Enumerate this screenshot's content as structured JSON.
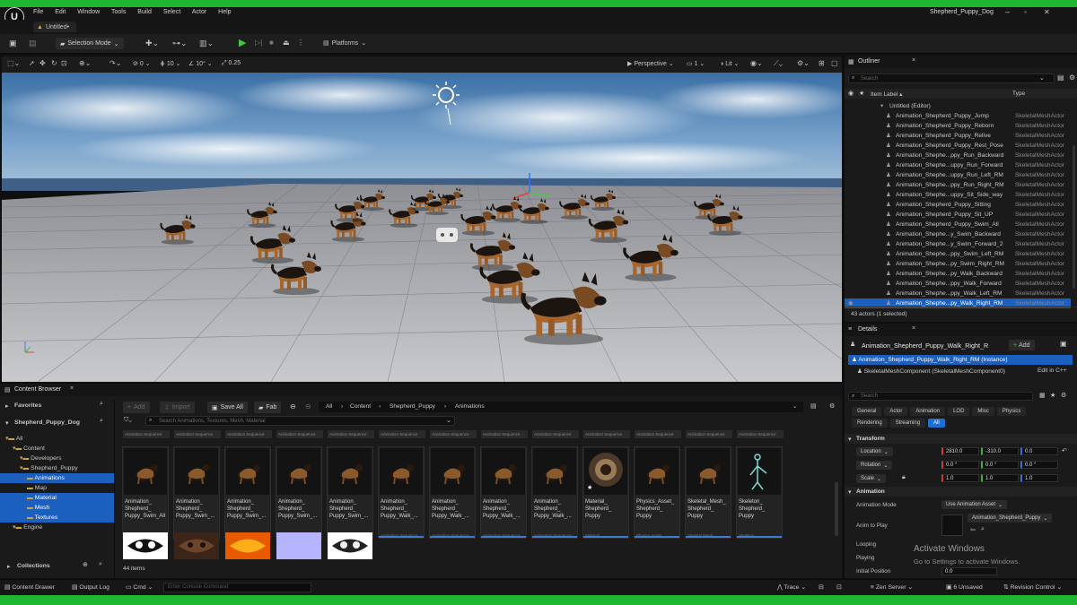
{
  "window": {
    "title": "Shepherd_Puppy_Dog"
  },
  "menu": [
    "File",
    "Edit",
    "Window",
    "Tools",
    "Build",
    "Select",
    "Actor",
    "Help"
  ],
  "tabs": [
    {
      "label": "Untitled•"
    }
  ],
  "toolbar": {
    "selection_mode": "Selection Mode",
    "platforms": "Platforms"
  },
  "viewport_bar": {
    "rot_snap": "0",
    "grid_snap": "10",
    "angle_snap": "10°",
    "scale_snap": "0.25",
    "perspective": "Perspective",
    "camera_count": "1",
    "view_mode": "Lit"
  },
  "outliner": {
    "title": "Outliner",
    "search_placeholder": "Search",
    "col_label": "Item Label ▴",
    "col_type": "Type",
    "root": "Untitled (Editor)",
    "rows": [
      {
        "name": "Animation_Shepherd_Puppy_Jump",
        "type": "SkeletalMeshActor"
      },
      {
        "name": "Animation_Shepherd_Puppy_Reborn",
        "type": "SkeletalMeshActor"
      },
      {
        "name": "Animation_Shepherd_Puppy_Relive",
        "type": "SkeletalMeshActor"
      },
      {
        "name": "Animation_Shepherd_Puppy_Rest_Pose",
        "type": "SkeletalMeshActor"
      },
      {
        "name": "Animation_Shephe...ppy_Run_Backward",
        "type": "SkeletalMeshActor"
      },
      {
        "name": "Animation_Shephe...uppy_Run_Forward",
        "type": "SkeletalMeshActor"
      },
      {
        "name": "Animation_Shephe...uppy_Run_Left_RM",
        "type": "SkeletalMeshActor"
      },
      {
        "name": "Animation_Shephe...ppy_Run_Right_RM",
        "type": "SkeletalMeshActor"
      },
      {
        "name": "Animation_Shephe...uppy_Sit_Side_way",
        "type": "SkeletalMeshActor"
      },
      {
        "name": "Animation_Shepherd_Puppy_Sitting",
        "type": "SkeletalMeshActor"
      },
      {
        "name": "Animation_Shepherd_Puppy_Sit_UP",
        "type": "SkeletalMeshActor"
      },
      {
        "name": "Animation_Shepherd_Puppy_Swim_All",
        "type": "SkeletalMeshActor"
      },
      {
        "name": "Animation_Shephe...y_Swim_Backward",
        "type": "SkeletalMeshActor"
      },
      {
        "name": "Animation_Shephe...y_Swim_Forward_2",
        "type": "SkeletalMeshActor"
      },
      {
        "name": "Animation_Shephe...ppy_Swim_Left_RM",
        "type": "SkeletalMeshActor"
      },
      {
        "name": "Animation_Shephe...py_Swim_Right_RM",
        "type": "SkeletalMeshActor"
      },
      {
        "name": "Animation_Shephe...py_Walk_Backward",
        "type": "SkeletalMeshActor"
      },
      {
        "name": "Animation_Shephe...ppy_Walk_Forward",
        "type": "SkeletalMeshActor"
      },
      {
        "name": "Animation_Shephe...ppy_Walk_Left_RM",
        "type": "SkeletalMeshActor"
      },
      {
        "name": "Animation_Shephe...py_Walk_Right_RM",
        "type": "SkeletalMeshActor"
      }
    ],
    "status": "43 actors (1 selected)"
  },
  "details": {
    "title": "Details",
    "actor": "Animation_Shepherd_Puppy_Walk_Right_R",
    "add": "Add",
    "instance": "Animation_Shepherd_Puppy_Walk_Right_RM (Instance)",
    "component": "SkeletalMeshComponent (SkeletalMeshComponent0)",
    "edit_cpp": "Edit in C++",
    "search_placeholder": "Search",
    "tabs": [
      "General",
      "Actor",
      "Animation",
      "LOD",
      "Misc",
      "Physics",
      "Rendering",
      "Streaming",
      "All"
    ],
    "transform": {
      "title": "Transform",
      "location_label": "Location",
      "rotation_label": "Rotation",
      "scale_label": "Scale",
      "location": [
        "2810.0",
        "-310.0",
        "0.0"
      ],
      "rotation": [
        "0.0 °",
        "0.0 °",
        "0.0 °"
      ],
      "scale": [
        "1.0",
        "1.0",
        "1.0"
      ]
    },
    "animation": {
      "title": "Animation",
      "mode_label": "Animation Mode",
      "mode_value": "Use Animation Asset",
      "anim_label": "Anim to Play",
      "anim_value": "Animation_Shepherd_Puppy",
      "looping": "Looping",
      "playing": "Playing",
      "initial_position": "Initial Position",
      "initial_value": "0.0"
    },
    "watermark_title": "Activate Windows",
    "watermark_sub": "Go to Settings to activate Windows."
  },
  "content_browser": {
    "title": "Content Browser",
    "favorites": "Favorites",
    "project": "Shepherd_Puppy_Dog",
    "add": "Add",
    "import": "Import",
    "save_all": "Save All",
    "fab": "Fab",
    "breadcrumb": [
      "All",
      "Content",
      "Shepherd_Puppy",
      "Animations"
    ],
    "search_placeholder": "Search Animations, Textures, Mesh, Material",
    "tree": [
      {
        "label": "All",
        "indent": 0,
        "sel": false
      },
      {
        "label": "Content",
        "indent": 1,
        "sel": false
      },
      {
        "label": "Developers",
        "indent": 2,
        "sel": false
      },
      {
        "label": "Shepherd_Puppy",
        "indent": 2,
        "sel": false
      },
      {
        "label": "Animations",
        "indent": 3,
        "sel": true
      },
      {
        "label": "Map",
        "indent": 3,
        "sel": false
      },
      {
        "label": "Material",
        "indent": 3,
        "sel": true
      },
      {
        "label": "Mesh",
        "indent": 3,
        "sel": true
      },
      {
        "label": "Textures",
        "indent": 3,
        "sel": true
      },
      {
        "label": "Engine",
        "indent": 1,
        "sel": false
      }
    ],
    "type_headers": [
      "Animation Sequence",
      "Animation Sequence",
      "Animation Sequence",
      "Animation Sequence",
      "Animation Sequence",
      "Animation Sequence",
      "Animation Sequence",
      "Animation Sequence",
      "Animation Sequence",
      "Animation Sequence",
      "Animation Sequence",
      "Animation Sequence",
      "Animation Sequence"
    ],
    "assets": [
      {
        "name": "Animation_ Shepherd_ Puppy_Swim_All",
        "type": "Animation Sequence",
        "kind": "dog"
      },
      {
        "name": "Animation_ Shepherd_ Puppy_Swim_...",
        "type": "Animation Sequence",
        "kind": "dog"
      },
      {
        "name": "Animation_ Shepherd_ Puppy_Swim_...",
        "type": "Animation Sequence",
        "kind": "dog"
      },
      {
        "name": "Animation_ Shepherd_ Puppy_Swim_...",
        "type": "Animation Sequence",
        "kind": "dog"
      },
      {
        "name": "Animation_ Shepherd_ Puppy_Swim_...",
        "type": "Animation Sequence",
        "kind": "dog"
      },
      {
        "name": "Animation_ Shepherd_ Puppy_Walk_...",
        "type": "Animation Sequence",
        "kind": "dog"
      },
      {
        "name": "Animation_ Shepherd_ Puppy_Walk_...",
        "type": "Animation Sequence",
        "kind": "dog"
      },
      {
        "name": "Animation_ Shepherd_ Puppy_Walk_...",
        "type": "Animation Sequence",
        "kind": "dog"
      },
      {
        "name": "Animation_ Shepherd_ Puppy_Walk_...",
        "type": "Animation Sequence",
        "kind": "dog"
      },
      {
        "name": "Material_ Shepherd_ Puppy",
        "type": "Material",
        "kind": "sphere"
      },
      {
        "name": "Physics_Asset_ Shepherd_ Puppy",
        "type": "Physics Asset",
        "kind": "dog"
      },
      {
        "name": "Skeletal_Mesh_ Shepherd_ Puppy",
        "type": "Skeletal Mesh",
        "kind": "dog"
      },
      {
        "name": "Skeleton_ Shepherd_ Puppy",
        "type": "Skeleton",
        "kind": "skeleton"
      }
    ],
    "item_count": "44 items",
    "collections": "Collections"
  },
  "statusbar": {
    "content_drawer": "Content Drawer",
    "output_log": "Output Log",
    "cmd": "Cmd",
    "console_placeholder": "Enter Console Command",
    "trace": "Trace",
    "zen_server": "Zen Server",
    "unsaved": "6 Unsaved",
    "revision_control": "Revision Control"
  }
}
